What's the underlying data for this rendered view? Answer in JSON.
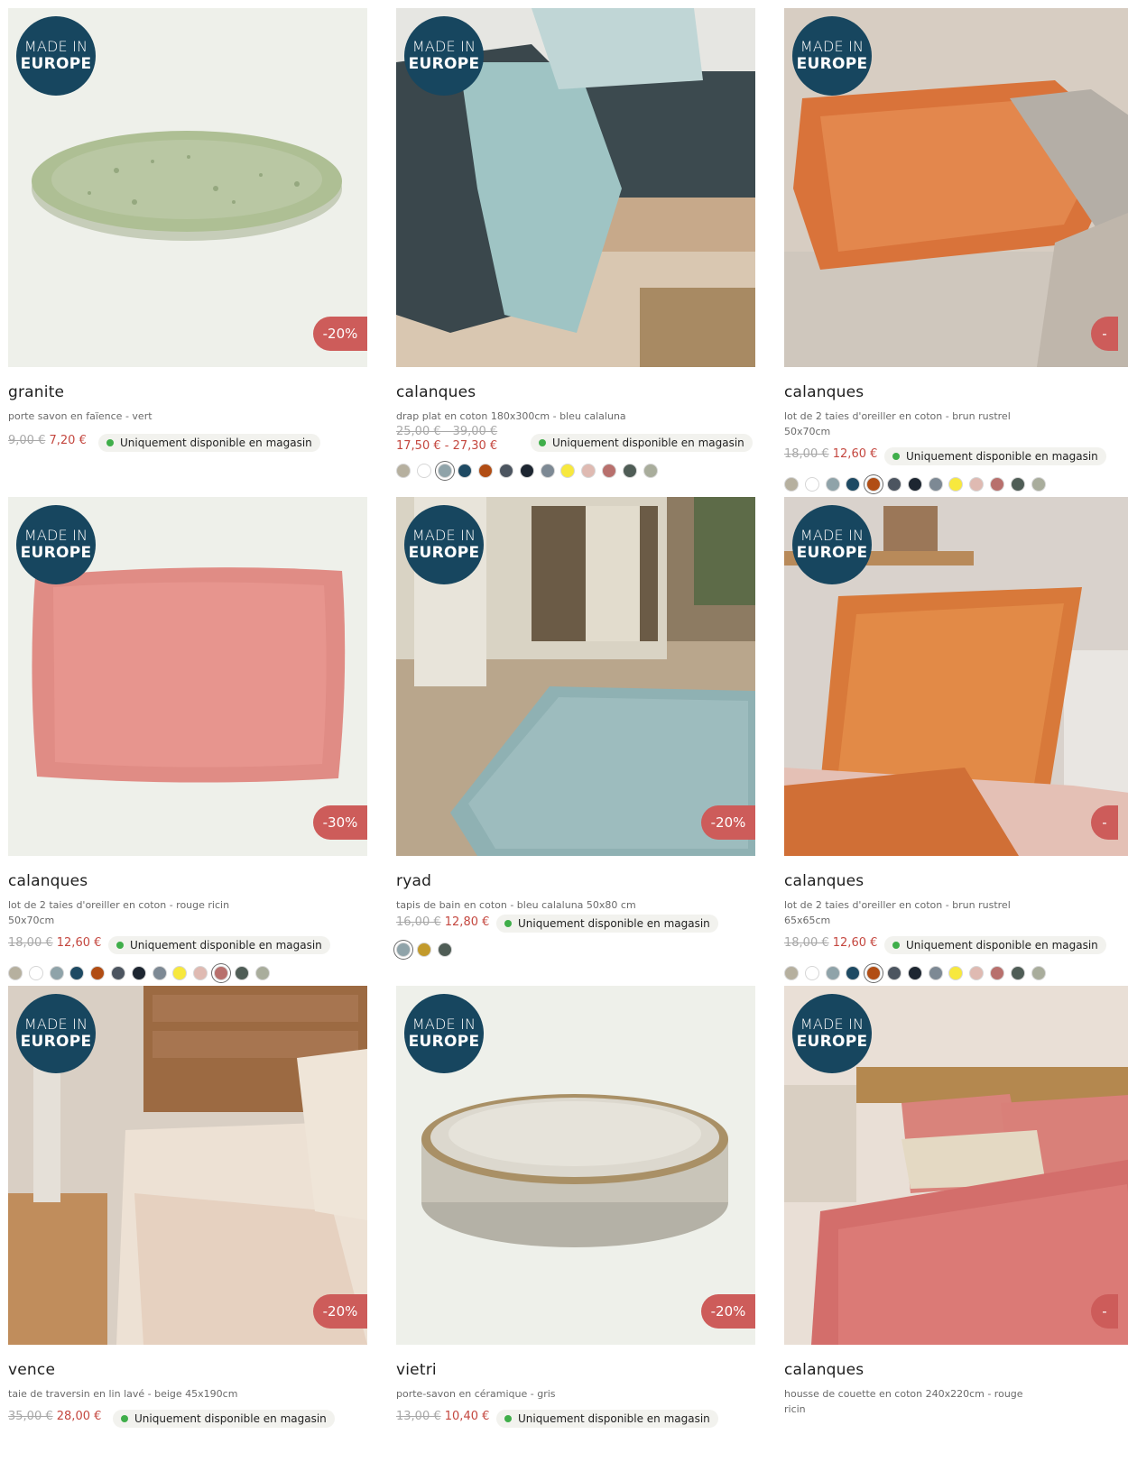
{
  "badge": {
    "line1": "MADE IN",
    "line2": "EUROPE"
  },
  "availability": "Uniquement disponible en magasin",
  "colors": {
    "price_sale": "#c4473f",
    "badge_bg": "#17465f",
    "discount_bg": "#cd5c5a",
    "in_stock_dot": "#3fae4a"
  },
  "products": [
    {
      "name": "granite",
      "desc": "porte savon en faïence - vert",
      "old_price": "9,00 €",
      "new_price": "7,20 €",
      "discount": "-20%"
    },
    {
      "name": "calanques",
      "desc": "drap plat en coton 180x300cm - bleu calaluna",
      "old_price": "25,00 € - 39,00 €",
      "new_price": "17,50 € - 27,30 €",
      "swatches": [
        "#b6b09f",
        "#ffffff",
        "#8fa3a9",
        "#1e4a63",
        "#b14d14",
        "#4c5560",
        "#1d2631",
        "#7d8994",
        "#f7e83e",
        "#dfbab2",
        "#b8706d",
        "#4f5d56",
        "#a9ad9c"
      ],
      "selected_swatch": 2
    },
    {
      "name": "calanques",
      "desc": "lot de 2 taies d'oreiller en coton - brun rustrel",
      "desc2": "50x70cm",
      "old_price": "18,00 €",
      "new_price": "12,60 €",
      "discount": "-",
      "swatches": [
        "#b6b09f",
        "#ffffff",
        "#8fa3a9",
        "#1e4a63",
        "#b14d14",
        "#4c5560",
        "#1d2631",
        "#7d8994",
        "#f7e83e",
        "#dfbab2",
        "#b8706d",
        "#4f5d56",
        "#a9ad9c"
      ],
      "selected_swatch": 4
    },
    {
      "name": "calanques",
      "desc": "lot de 2 taies d'oreiller en coton - rouge ricin",
      "desc2": "50x70cm",
      "old_price": "18,00 €",
      "new_price": "12,60 €",
      "discount": "-30%",
      "swatches": [
        "#b6b09f",
        "#ffffff",
        "#8fa3a9",
        "#1e4a63",
        "#b14d14",
        "#4c5560",
        "#1d2631",
        "#7d8994",
        "#f7e83e",
        "#dfbab2",
        "#b8706d",
        "#4f5d56",
        "#a9ad9c"
      ],
      "selected_swatch": 10
    },
    {
      "name": "ryad",
      "desc": "tapis de bain en coton - bleu calaluna 50x80 cm",
      "old_price": "16,00 €",
      "new_price": "12,80 €",
      "discount": "-20%",
      "swatches": [
        "#8fa3a9",
        "#c29a2c",
        "#4f5d56"
      ],
      "selected_swatch": 0
    },
    {
      "name": "calanques",
      "desc": "lot de 2 taies d'oreiller en coton - brun rustrel",
      "desc2": "65x65cm",
      "old_price": "18,00 €",
      "new_price": "12,60 €",
      "discount": "-",
      "swatches": [
        "#b6b09f",
        "#ffffff",
        "#8fa3a9",
        "#1e4a63",
        "#b14d14",
        "#4c5560",
        "#1d2631",
        "#7d8994",
        "#f7e83e",
        "#dfbab2",
        "#b8706d",
        "#4f5d56",
        "#a9ad9c"
      ],
      "selected_swatch": 4
    },
    {
      "name": "vence",
      "desc": "taie de traversin en lin lavé - beige 45x190cm",
      "old_price": "35,00 €",
      "new_price": "28,00 €",
      "discount": "-20%"
    },
    {
      "name": "vietri",
      "desc": "porte-savon en céramique - gris",
      "old_price": "13,00 €",
      "new_price": "10,40 €",
      "discount": "-20%"
    },
    {
      "name": "calanques",
      "desc": "housse de couette en coton 240x220cm - rouge",
      "desc2": "ricin",
      "discount": "-"
    }
  ]
}
